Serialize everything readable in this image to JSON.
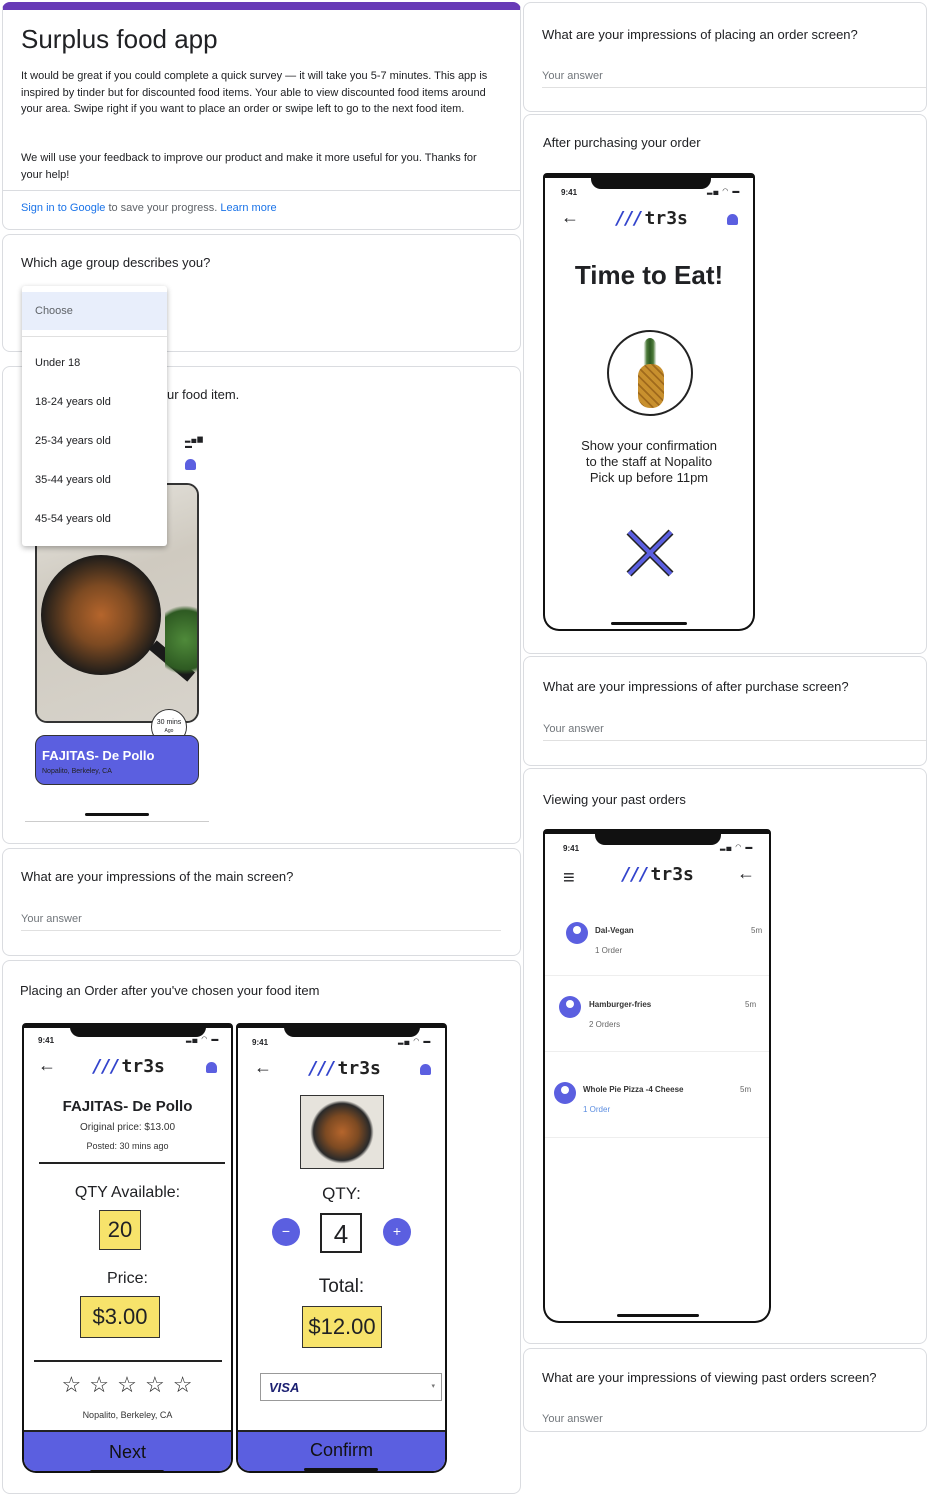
{
  "form": {
    "title": "Surplus food app",
    "intro_1": "It would be great if you could complete a quick survey — it will take you 5-7 minutes. This app is inspired by tinder but for discounted food items. Your able to view discounted food items around your area. Swipe right if you want to place an order or swipe left to go to the next food item.",
    "intro_2": "We will use your feedback to improve our product and make it more useful for you. Thanks for your help!",
    "sign_in_link": "Sign in to Google",
    "sign_in_text": "to save your progress.",
    "learn_more": "Learn more",
    "accent_color": "#673ab7"
  },
  "age": {
    "question": "Which age group describes you?",
    "selected": "Choose",
    "options": [
      "Under 18",
      "18-24 years old",
      "25-34 years old",
      "35-44 years old",
      "45-54 years old"
    ]
  },
  "main_screen": {
    "caption_visible": "ur food item.",
    "food_name": "FAJITAS- De Pollo",
    "food_location": "Nopalito, Berkeley, CA",
    "badge_line1": "30 mins",
    "badge_line2": "Ago"
  },
  "q_main": {
    "question": "What are your impressions of the main screen?",
    "placeholder": "Your answer"
  },
  "placing": {
    "caption": "Placing an Order after you've chosen your food item",
    "time": "9:41",
    "logo_slashes": "///",
    "logo_text": "tr3s",
    "screen1": {
      "title": "FAJITAS- De Pollo",
      "original_price": "Original price: $13.00",
      "posted": "Posted: 30 mins ago",
      "qty_label": "QTY Available:",
      "qty_value": "20",
      "price_label": "Price:",
      "price_value": "$3.00",
      "stars": "☆ ☆ ☆ ☆ ☆",
      "location": "Nopalito, Berkeley, CA",
      "button": "Next"
    },
    "screen2": {
      "qty_label": "QTY:",
      "qty_value": "4",
      "minus": "−",
      "plus": "+",
      "total_label": "Total:",
      "total_value": "$12.00",
      "card": "VISA",
      "button": "Confirm"
    }
  },
  "q_order": {
    "question": "What are your impressions of placing an order screen?",
    "placeholder": "Your answer"
  },
  "after_purchase": {
    "caption": "After purchasing your order",
    "time": "9:41",
    "heading": "Time to Eat!",
    "line1": "Show your confirmation",
    "line2": "to the staff at Nopalito",
    "line3": "Pick up before 11pm"
  },
  "q_after": {
    "question": "What are your impressions of after purchase screen?",
    "placeholder": "Your answer"
  },
  "past_orders": {
    "caption": "Viewing your past orders",
    "time": "9:41",
    "rows": [
      {
        "name": "Dal-Vegan",
        "sub": "1 Order",
        "time": "5m"
      },
      {
        "name": "Hamburger-fries",
        "sub": "2 Orders",
        "time": "5m"
      },
      {
        "name": "Whole Pie Pizza -4 Cheese",
        "sub": "1 Order",
        "time": "5m"
      }
    ]
  },
  "q_past": {
    "question": "What are your impressions of viewing past orders screen?",
    "placeholder": "Your answer"
  }
}
